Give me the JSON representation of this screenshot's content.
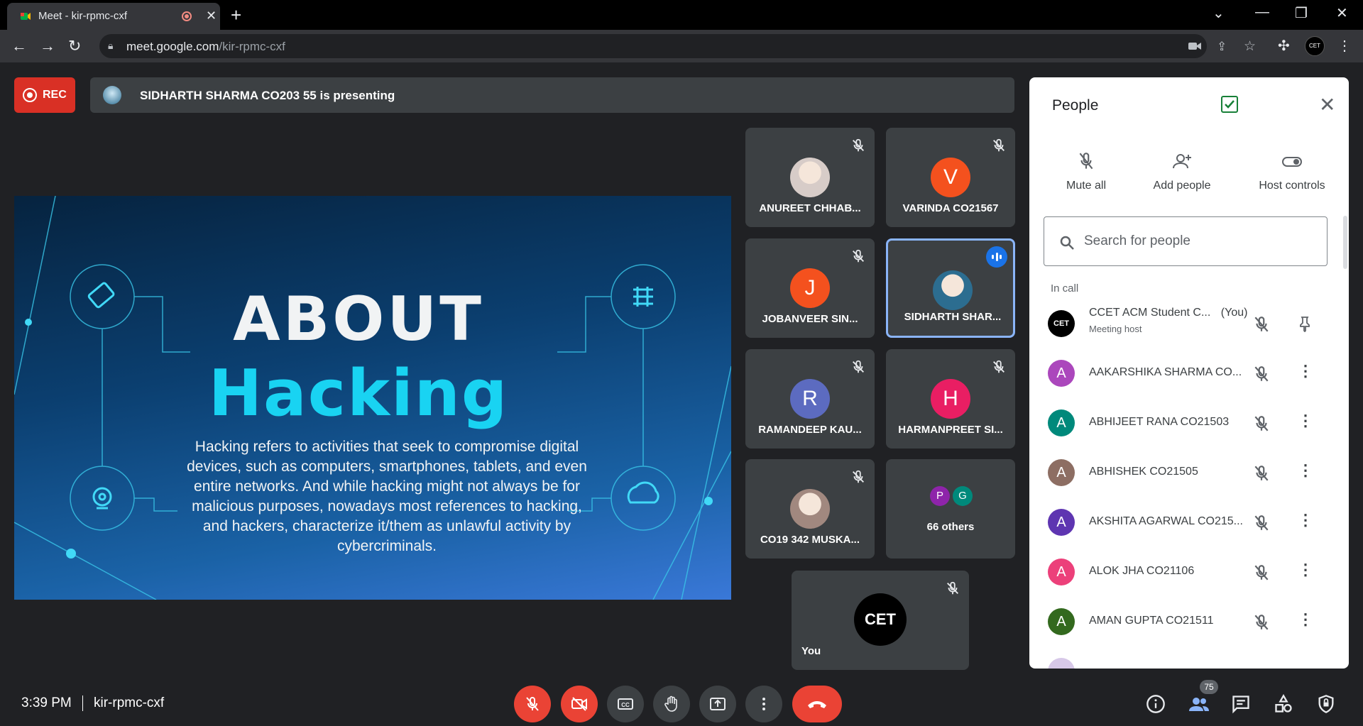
{
  "browser": {
    "tab_title": "Meet - kir-rpmc-cxf",
    "url_host": "meet.google.com",
    "url_path": "/kir-rpmc-cxf",
    "profile_label": "CET"
  },
  "meet": {
    "rec_label": "REC",
    "presenting_text": "SIDHARTH SHARMA CO203 55 is presenting",
    "clock": "3:39 PM",
    "meeting_code": "kir-rpmc-cxf",
    "participant_count": "75"
  },
  "slide": {
    "heading1": "ABOUT",
    "heading2": "Hacking",
    "body": "Hacking refers to activities that seek to compromise digital devices, such as computers, smartphones, tablets, and even entire networks. And while hacking might not always be for malicious purposes, nowadays most references to hacking, and hackers, characterize it/them as unlawful activity by cybercriminals."
  },
  "tiles": [
    {
      "name": "ANUREET CHHAB...",
      "initial": "",
      "color": "#d7ccc8",
      "kind": "photo"
    },
    {
      "name": "VARINDA CO21567",
      "initial": "V",
      "color": "#f4511e",
      "kind": "letter"
    },
    {
      "name": "JOBANVEER SIN...",
      "initial": "J",
      "color": "#f4511e",
      "kind": "letter"
    },
    {
      "name": "SIDHARTH SHAR...",
      "initial": "",
      "color": "#2c6d90",
      "kind": "photo",
      "active": true
    },
    {
      "name": "RAMANDEEP KAU...",
      "initial": "R",
      "color": "#5c6bc0",
      "kind": "letter"
    },
    {
      "name": "HARMANPREET SI...",
      "initial": "H",
      "color": "#e91e63",
      "kind": "letter"
    },
    {
      "name": "CO19 342 MUSKA...",
      "initial": "",
      "color": "#a1887f",
      "kind": "photo"
    },
    {
      "name": "66 others",
      "initial": "",
      "color": "",
      "kind": "others"
    }
  ],
  "others_avatars": [
    {
      "initial": "P",
      "color": "#8e24aa"
    },
    {
      "initial": "G",
      "color": "#00897b"
    }
  ],
  "self_tile": {
    "name": "You",
    "logo": "CET"
  },
  "panel": {
    "title": "People",
    "actions": [
      {
        "label": "Mute all",
        "icon": "mic-off-icon"
      },
      {
        "label": "Add people",
        "icon": "person-add-icon"
      },
      {
        "label": "Host controls",
        "icon": "toggle-icon"
      }
    ],
    "search_placeholder": "Search for people",
    "in_call_label": "In call",
    "people": [
      {
        "name": "CCET ACM Student C...",
        "suffix": "(You)",
        "sub": "Meeting host",
        "initial": "CET",
        "color": "#000000",
        "action": "pin-icon"
      },
      {
        "name": "AAKARSHIKA SHARMA CO...",
        "initial": "A",
        "color": "#ab47bc",
        "action": "more-icon"
      },
      {
        "name": "ABHIJEET RANA CO21503",
        "initial": "A",
        "color": "#00897b",
        "action": "more-icon"
      },
      {
        "name": "ABHISHEK CO21505",
        "initial": "A",
        "color": "#8d6e63",
        "action": "more-icon"
      },
      {
        "name": "AKSHITA AGARWAL CO215...",
        "initial": "A",
        "color": "#5e35b1",
        "action": "more-icon"
      },
      {
        "name": "ALOK JHA CO21106",
        "initial": "A",
        "color": "#ec407a",
        "action": "more-icon"
      },
      {
        "name": "AMAN GUPTA CO21511",
        "initial": "A",
        "color": "#33691e",
        "action": "more-icon"
      }
    ]
  }
}
